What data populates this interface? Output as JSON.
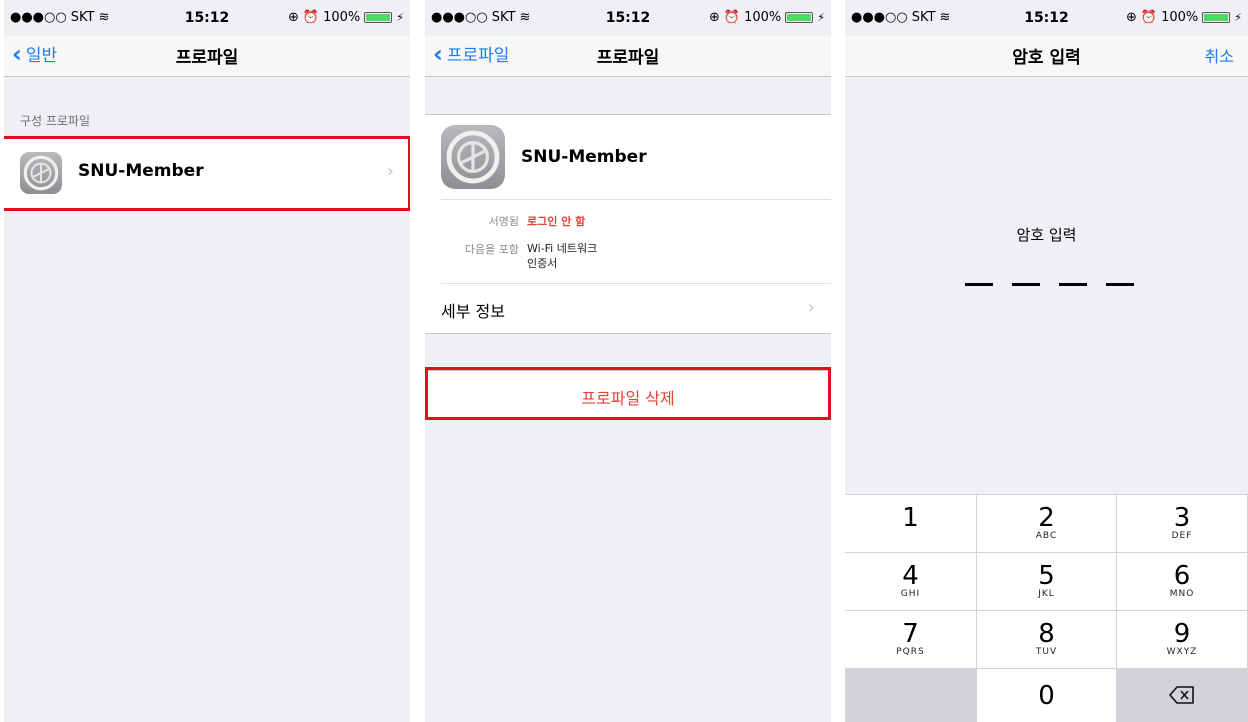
{
  "status": {
    "carrier": "SKT",
    "time": "15:12",
    "battery": "100%",
    "battery_level": 1.0
  },
  "panel1": {
    "back_label": "일반",
    "title": "프로파일",
    "section_header": "구성 프로파일",
    "profile_name": "SNU-Member"
  },
  "panel2": {
    "back_label": "프로파일",
    "title": "프로파일",
    "profile_name": "SNU-Member",
    "signed_label": "서명됨",
    "signed_value": "로그인 안 함",
    "contains_label": "다음을 포함",
    "contains_values": [
      "Wi-Fi 네트워크",
      "인증서"
    ],
    "details_label": "세부 정보",
    "delete_label": "프로파일 삭제"
  },
  "panel3": {
    "title": "암호 입력",
    "cancel_label": "취소",
    "prompt": "암호 입력",
    "keys": [
      {
        "num": "1",
        "letters": ""
      },
      {
        "num": "2",
        "letters": "ABC"
      },
      {
        "num": "3",
        "letters": "DEF"
      },
      {
        "num": "4",
        "letters": "GHI"
      },
      {
        "num": "5",
        "letters": "JKL"
      },
      {
        "num": "6",
        "letters": "MNO"
      },
      {
        "num": "7",
        "letters": "PQRS"
      },
      {
        "num": "8",
        "letters": "TUV"
      },
      {
        "num": "9",
        "letters": "WXYZ"
      },
      {
        "num": "0",
        "letters": ""
      }
    ]
  },
  "colors": {
    "accent": "#1b7cf5",
    "destructive": "#e0463c",
    "highlight": "#e10e1e"
  }
}
